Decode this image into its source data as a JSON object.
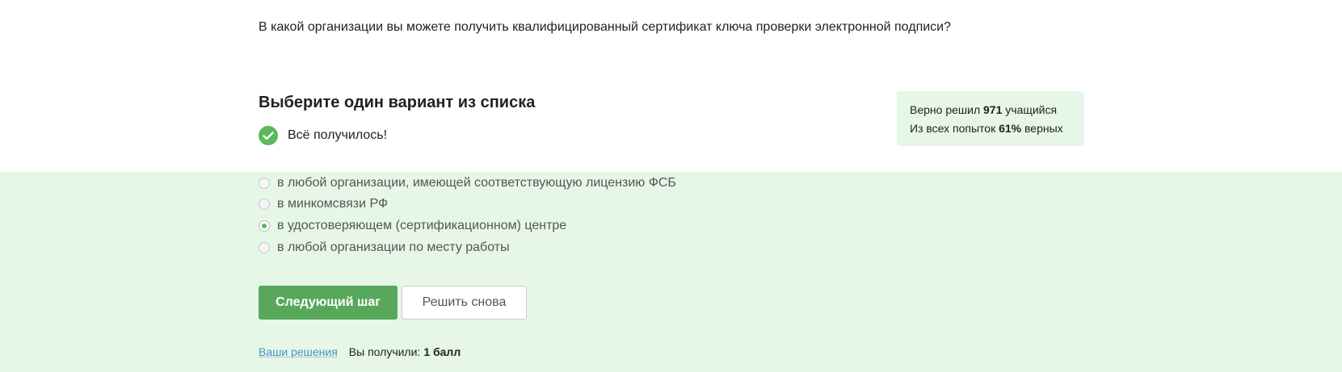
{
  "question": {
    "text": "В какой организации вы можете получить квалифицированный сертификат ключа проверки электронной подписи?"
  },
  "task": {
    "heading": "Выберите один вариант из списка",
    "status_icon": "check-circle-icon",
    "status_text": "Всё получилось!"
  },
  "stats": {
    "solved_prefix": "Верно решил",
    "solved_count": "971",
    "solved_suffix": "учащийся",
    "attempts_prefix": "Из всех попыток",
    "attempts_percent": "61%",
    "attempts_suffix": "верных"
  },
  "options": [
    {
      "label": "в любой организации, имеющей соответствующую лицензию ФСБ",
      "selected": false
    },
    {
      "label": "в минкомсвязи РФ",
      "selected": false
    },
    {
      "label": "в удостоверяющем (сертификационном) центре",
      "selected": true
    },
    {
      "label": "в любой организации по месту работы",
      "selected": false
    }
  ],
  "actions": {
    "next_label": "Следующий шаг",
    "retry_label": "Решить снова"
  },
  "footer": {
    "solutions_link": "Ваши решения",
    "score_label": "Вы получили:",
    "score_value": "1 балл"
  },
  "colors": {
    "accent_green": "#57a85b",
    "answer_background": "#e6f7e8",
    "link_blue": "#4a90c8"
  }
}
